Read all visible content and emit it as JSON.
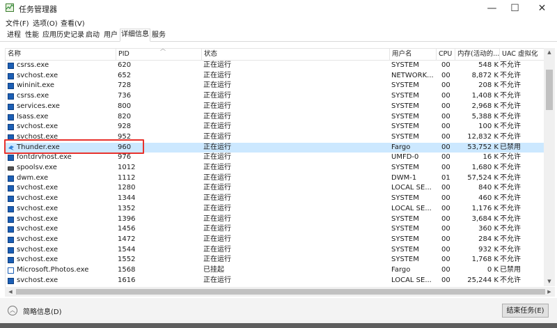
{
  "window": {
    "title": "任务管理器",
    "minimize": "—",
    "maximize": "☐",
    "close": "✕"
  },
  "menu": [
    "文件(F)",
    "选项(O)",
    "查看(V)"
  ],
  "tabs": [
    "进程",
    "性能",
    "应用历史记录",
    "启动",
    "用户",
    "详细信息",
    "服务"
  ],
  "active_tab": 5,
  "columns": [
    "名称",
    "PID",
    "状态",
    "用户名",
    "CPU",
    "内存(活动的...",
    "UAC 虚拟化"
  ],
  "rows": [
    {
      "icon": "process-icon",
      "name": "csrss.exe",
      "pid": "620",
      "status": "正在运行",
      "user": "SYSTEM",
      "cpu": "00",
      "mem": "548 K",
      "uac": "不允许"
    },
    {
      "icon": "process-icon",
      "name": "svchost.exe",
      "pid": "652",
      "status": "正在运行",
      "user": "NETWORK...",
      "cpu": "00",
      "mem": "8,872 K",
      "uac": "不允许"
    },
    {
      "icon": "process-icon",
      "name": "wininit.exe",
      "pid": "728",
      "status": "正在运行",
      "user": "SYSTEM",
      "cpu": "00",
      "mem": "208 K",
      "uac": "不允许"
    },
    {
      "icon": "process-icon",
      "name": "csrss.exe",
      "pid": "736",
      "status": "正在运行",
      "user": "SYSTEM",
      "cpu": "00",
      "mem": "1,408 K",
      "uac": "不允许"
    },
    {
      "icon": "process-icon",
      "name": "services.exe",
      "pid": "800",
      "status": "正在运行",
      "user": "SYSTEM",
      "cpu": "00",
      "mem": "2,968 K",
      "uac": "不允许"
    },
    {
      "icon": "process-icon",
      "name": "lsass.exe",
      "pid": "820",
      "status": "正在运行",
      "user": "SYSTEM",
      "cpu": "00",
      "mem": "5,388 K",
      "uac": "不允许"
    },
    {
      "icon": "process-icon",
      "name": "svchost.exe",
      "pid": "928",
      "status": "正在运行",
      "user": "SYSTEM",
      "cpu": "00",
      "mem": "100 K",
      "uac": "不允许"
    },
    {
      "icon": "process-icon",
      "name": "svchost.exe",
      "pid": "952",
      "status": "正在运行",
      "user": "SYSTEM",
      "cpu": "00",
      "mem": "12,832 K",
      "uac": "不允许"
    },
    {
      "icon": "thunder-icon",
      "name": "Thunder.exe",
      "pid": "960",
      "status": "正在运行",
      "user": "Fargo",
      "cpu": "00",
      "mem": "53,752 K",
      "uac": "已禁用"
    },
    {
      "icon": "process-icon",
      "name": "fontdrvhost.exe",
      "pid": "976",
      "status": "正在运行",
      "user": "UMFD-0",
      "cpu": "00",
      "mem": "16 K",
      "uac": "不允许"
    },
    {
      "icon": "printer-icon",
      "name": "spoolsv.exe",
      "pid": "1012",
      "status": "正在运行",
      "user": "SYSTEM",
      "cpu": "00",
      "mem": "1,680 K",
      "uac": "不允许"
    },
    {
      "icon": "process-icon",
      "name": "dwm.exe",
      "pid": "1112",
      "status": "正在运行",
      "user": "DWM-1",
      "cpu": "01",
      "mem": "57,524 K",
      "uac": "不允许"
    },
    {
      "icon": "process-icon",
      "name": "svchost.exe",
      "pid": "1280",
      "status": "正在运行",
      "user": "LOCAL SE...",
      "cpu": "00",
      "mem": "840 K",
      "uac": "不允许"
    },
    {
      "icon": "process-icon",
      "name": "svchost.exe",
      "pid": "1344",
      "status": "正在运行",
      "user": "SYSTEM",
      "cpu": "00",
      "mem": "460 K",
      "uac": "不允许"
    },
    {
      "icon": "process-icon",
      "name": "svchost.exe",
      "pid": "1352",
      "status": "正在运行",
      "user": "LOCAL SE...",
      "cpu": "00",
      "mem": "1,176 K",
      "uac": "不允许"
    },
    {
      "icon": "process-icon",
      "name": "svchost.exe",
      "pid": "1396",
      "status": "正在运行",
      "user": "SYSTEM",
      "cpu": "00",
      "mem": "3,684 K",
      "uac": "不允许"
    },
    {
      "icon": "process-icon",
      "name": "svchost.exe",
      "pid": "1456",
      "status": "正在运行",
      "user": "SYSTEM",
      "cpu": "00",
      "mem": "360 K",
      "uac": "不允许"
    },
    {
      "icon": "process-icon",
      "name": "svchost.exe",
      "pid": "1472",
      "status": "正在运行",
      "user": "SYSTEM",
      "cpu": "00",
      "mem": "284 K",
      "uac": "不允许"
    },
    {
      "icon": "process-icon",
      "name": "svchost.exe",
      "pid": "1544",
      "status": "正在运行",
      "user": "SYSTEM",
      "cpu": "00",
      "mem": "932 K",
      "uac": "不允许"
    },
    {
      "icon": "process-icon",
      "name": "svchost.exe",
      "pid": "1552",
      "status": "正在运行",
      "user": "SYSTEM",
      "cpu": "00",
      "mem": "1,768 K",
      "uac": "不允许"
    },
    {
      "icon": "photos-icon",
      "name": "Microsoft.Photos.exe",
      "pid": "1568",
      "status": "已挂起",
      "user": "Fargo",
      "cpu": "00",
      "mem": "0 K",
      "uac": "已禁用"
    },
    {
      "icon": "process-icon",
      "name": "svchost.exe",
      "pid": "1616",
      "status": "正在运行",
      "user": "LOCAL SE...",
      "cpu": "00",
      "mem": "25,244 K",
      "uac": "不允许"
    }
  ],
  "selected_row": 8,
  "footer": {
    "fewer_details": "简略信息(D)",
    "end_task": "结束任务(E)"
  },
  "colors": {
    "selection": "#cce8ff",
    "highlight_box": "#e8322c"
  }
}
